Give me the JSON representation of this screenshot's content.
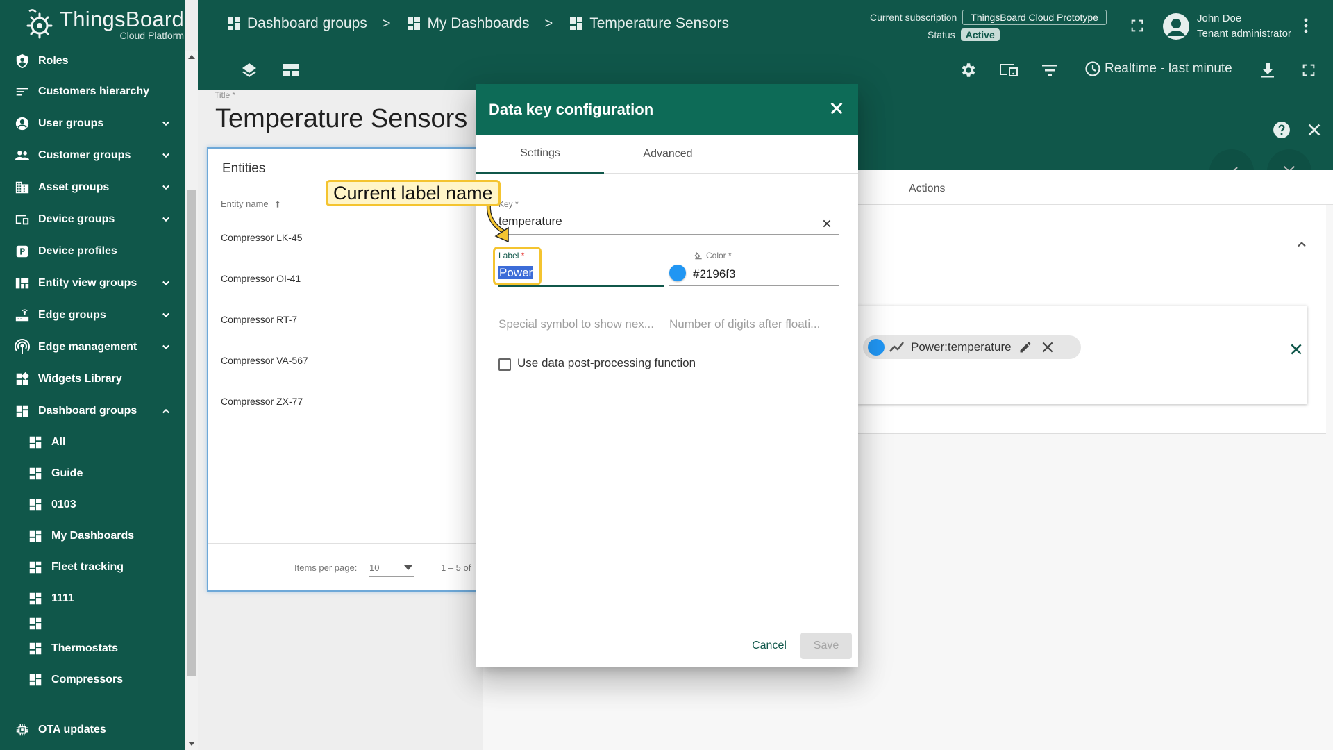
{
  "brand": {
    "title": "ThingsBoard",
    "subtitle": "Cloud Platform"
  },
  "sidebar": {
    "items": [
      {
        "label": "Roles",
        "icon": "shield-icon",
        "expandable": false
      },
      {
        "label": "Customers hierarchy",
        "icon": "hierarchy-icon",
        "expandable": false
      },
      {
        "label": "User groups",
        "icon": "account-circle-icon",
        "expandable": true
      },
      {
        "label": "Customer groups",
        "icon": "people-icon",
        "expandable": true
      },
      {
        "label": "Asset groups",
        "icon": "domain-icon",
        "expandable": true
      },
      {
        "label": "Device groups",
        "icon": "devices-icon",
        "expandable": true
      },
      {
        "label": "Device profiles",
        "icon": "device-profile-icon",
        "expandable": false
      },
      {
        "label": "Entity view groups",
        "icon": "view-quilt-icon",
        "expandable": true
      },
      {
        "label": "Edge groups",
        "icon": "router-icon",
        "expandable": true
      },
      {
        "label": "Edge management",
        "icon": "wifi-tethering-icon",
        "expandable": true
      },
      {
        "label": "Widgets Library",
        "icon": "widgets-icon",
        "expandable": false
      },
      {
        "label": "Dashboard groups",
        "icon": "dashboard-icon",
        "expandable": true,
        "expanded": true
      }
    ],
    "subitems": [
      {
        "label": "All"
      },
      {
        "label": "Guide"
      },
      {
        "label": "0103"
      },
      {
        "label": "My Dashboards"
      },
      {
        "label": "Fleet tracking"
      },
      {
        "label": "1111"
      },
      {
        "label": ""
      },
      {
        "label": "Thermostats"
      },
      {
        "label": "Compressors"
      }
    ],
    "bottom_item": {
      "label": "OTA updates",
      "icon": "memory-icon"
    }
  },
  "header": {
    "breadcrumbs": [
      "Dashboard groups",
      "My Dashboards",
      "Temperature Sensors"
    ],
    "separator": ">",
    "subscription_label": "Current subscription",
    "subscription_value": "ThingsBoard Cloud Prototype",
    "status_label": "Status",
    "status_value": "Active",
    "user_name": "John Doe",
    "user_role": "Tenant administrator",
    "timewindow": "Realtime - last minute"
  },
  "dashboard": {
    "title_label": "Title *",
    "title": "Temperature Sensors",
    "entities_widget": {
      "title": "Entities",
      "column": "Entity name",
      "rows": [
        "Compressor LK-45",
        "Compressor OI-41",
        "Compressor RT-7",
        "Compressor VA-567",
        "Compressor ZX-77"
      ],
      "items_per_page_label": "Items per page:",
      "items_per_page": "10",
      "range": "1 – 5 of"
    }
  },
  "editor": {
    "tab_actions": "Actions",
    "chip_prefix": "Power: ",
    "chip_key": "temperature",
    "chip_color": "#2196f3"
  },
  "dialog": {
    "title": "Data key configuration",
    "tabs": [
      "Settings",
      "Advanced"
    ],
    "key_label": "Key *",
    "key_value": "temperature",
    "label_label": "Label",
    "label_required": "*",
    "label_value": "Power",
    "color_label": "Color *",
    "color_value": "#2196f3",
    "special_symbol_placeholder": "Special symbol to show nex...",
    "digits_placeholder": "Number of digits after floati...",
    "postprocessing_label": "Use data post-processing function",
    "cancel": "Cancel",
    "save": "Save"
  },
  "annotation": {
    "callout_text": "Current label name"
  },
  "colors": {
    "primary": "#10574a",
    "dialog_header": "#0d6b57",
    "accent_blue": "#2196f3",
    "callout_border": "#f4c430"
  }
}
